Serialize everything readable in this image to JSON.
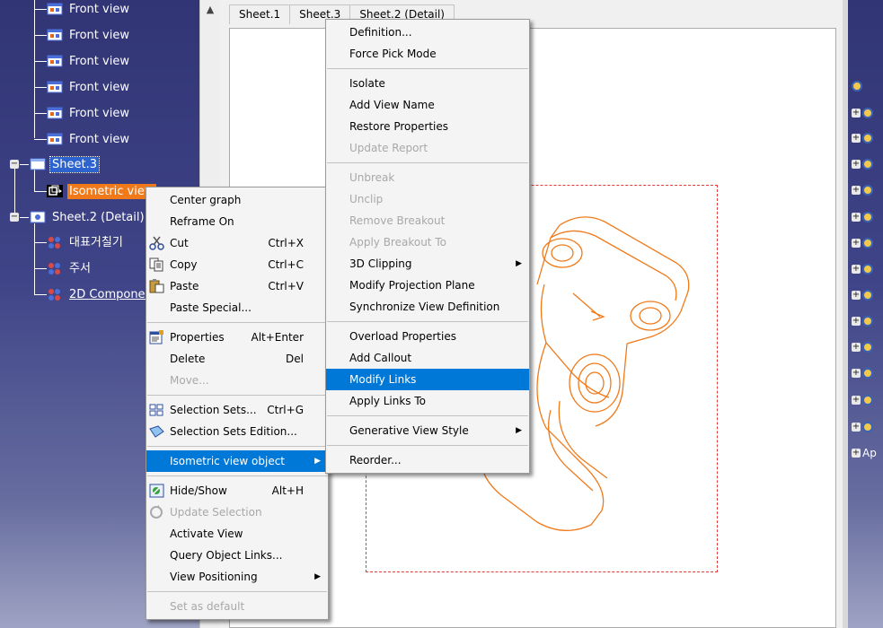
{
  "tree": {
    "front_views": [
      "Front view",
      "Front view",
      "Front view",
      "Front view",
      "Front view",
      "Front view"
    ],
    "sheet3": "Sheet.3",
    "isometric_view": "Isometric view",
    "sheet2_detail": "Sheet.2 (Detail)",
    "children": [
      "대표거칠기",
      "주서",
      "2D Component"
    ]
  },
  "tabs": [
    "Sheet.1",
    "Sheet.3",
    "Sheet.2 (Detail)"
  ],
  "context_menu": {
    "center_graph": "Center graph",
    "reframe_on": "Reframe On",
    "cut": "Cut",
    "cut_shortcut": "Ctrl+X",
    "copy": "Copy",
    "copy_shortcut": "Ctrl+C",
    "paste": "Paste",
    "paste_shortcut": "Ctrl+V",
    "paste_special": "Paste Special...",
    "properties": "Properties",
    "properties_shortcut": "Alt+Enter",
    "delete": "Delete",
    "delete_shortcut": "Del",
    "move": "Move...",
    "selection_sets": "Selection Sets...",
    "selection_sets_shortcut": "Ctrl+G",
    "selection_sets_edition": "Selection Sets Edition...",
    "isometric_view_object": "Isometric view object",
    "hide_show": "Hide/Show",
    "hide_show_shortcut": "Alt+H",
    "update_selection": "Update Selection",
    "activate_view": "Activate View",
    "query_object_links": "Query Object Links...",
    "view_positioning": "View Positioning",
    "set_as_default": "Set as default"
  },
  "submenu": {
    "definition": "Definition...",
    "force_pick_mode": "Force Pick Mode",
    "isolate": "Isolate",
    "add_view_name": "Add View Name",
    "restore_properties": "Restore Properties",
    "update_report": "Update Report",
    "unbreak": "Unbreak",
    "unclip": "Unclip",
    "remove_breakout": "Remove Breakout",
    "apply_breakout_to": "Apply Breakout To",
    "clipping_3d": "3D Clipping",
    "modify_projection_plane": "Modify Projection Plane",
    "synchronize_view_definition": "Synchronize View Definition",
    "overload_properties": "Overload Properties",
    "add_callout": "Add Callout",
    "modify_links": "Modify Links",
    "apply_links_to": "Apply Links To",
    "generative_view_style": "Generative View Style",
    "reorder": "Reorder..."
  },
  "right_panel": {
    "last_label": "Ap"
  },
  "colors": {
    "highlight": "#0078d7",
    "tree_bg": "#3b3f78",
    "drawing_stroke": "#f07a1a",
    "frame": "#e03a3a"
  }
}
